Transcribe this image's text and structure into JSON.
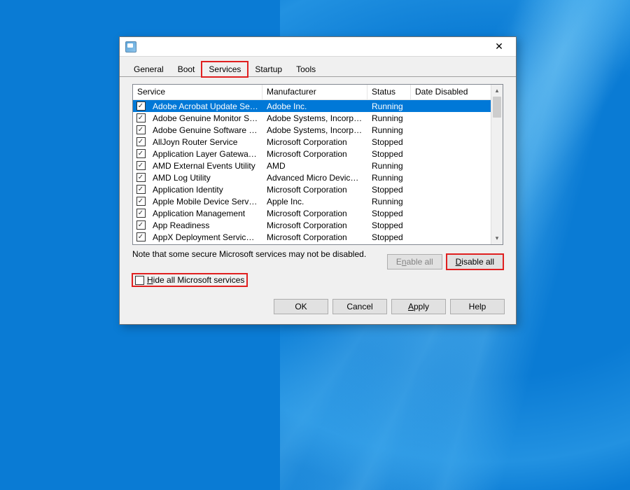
{
  "tabs": {
    "general": "General",
    "boot": "Boot",
    "services": "Services",
    "startup": "Startup",
    "tools": "Tools"
  },
  "columns": {
    "service": "Service",
    "manufacturer": "Manufacturer",
    "status": "Status",
    "date_disabled": "Date Disabled"
  },
  "rows": [
    {
      "svc": "Adobe Acrobat Update Service",
      "mfr": "Adobe Inc.",
      "st": "Running",
      "dd": ""
    },
    {
      "svc": "Adobe Genuine Monitor Service",
      "mfr": "Adobe Systems, Incorpora...",
      "st": "Running",
      "dd": ""
    },
    {
      "svc": "Adobe Genuine Software Integri...",
      "mfr": "Adobe Systems, Incorpora...",
      "st": "Running",
      "dd": ""
    },
    {
      "svc": "AllJoyn Router Service",
      "mfr": "Microsoft Corporation",
      "st": "Stopped",
      "dd": ""
    },
    {
      "svc": "Application Layer Gateway Service",
      "mfr": "Microsoft Corporation",
      "st": "Stopped",
      "dd": ""
    },
    {
      "svc": "AMD External Events Utility",
      "mfr": "AMD",
      "st": "Running",
      "dd": ""
    },
    {
      "svc": "AMD Log Utility",
      "mfr": "Advanced Micro Devices, I...",
      "st": "Running",
      "dd": ""
    },
    {
      "svc": "Application Identity",
      "mfr": "Microsoft Corporation",
      "st": "Stopped",
      "dd": ""
    },
    {
      "svc": "Apple Mobile Device Service",
      "mfr": "Apple Inc.",
      "st": "Running",
      "dd": ""
    },
    {
      "svc": "Application Management",
      "mfr": "Microsoft Corporation",
      "st": "Stopped",
      "dd": ""
    },
    {
      "svc": "App Readiness",
      "mfr": "Microsoft Corporation",
      "st": "Stopped",
      "dd": ""
    },
    {
      "svc": "AppX Deployment Service (AppX...",
      "mfr": "Microsoft Corporation",
      "st": "Stopped",
      "dd": ""
    }
  ],
  "note": "Note that some secure Microsoft services may not be disabled.",
  "buttons": {
    "enable_all_pre": "E",
    "enable_all_u": "n",
    "enable_all_post": "able all",
    "disable_all_pre": "",
    "disable_all_u": "D",
    "disable_all_post": "isable all",
    "ok": "OK",
    "cancel": "Cancel",
    "apply_pre": "",
    "apply_u": "A",
    "apply_post": "pply",
    "help": "Help"
  },
  "hide_label_pre": "",
  "hide_label_u": "H",
  "hide_label_post": "ide all Microsoft services",
  "close_glyph": "✕"
}
